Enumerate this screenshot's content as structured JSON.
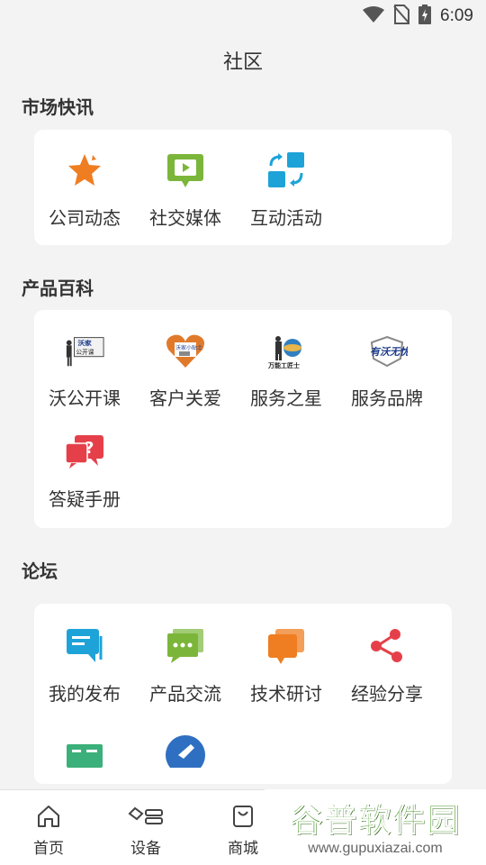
{
  "status": {
    "time": "6:09"
  },
  "header": {
    "title": "社区"
  },
  "sections": [
    {
      "title": "市场快讯",
      "items": [
        {
          "label": "公司动态",
          "icon": "star-icon"
        },
        {
          "label": "社交媒体",
          "icon": "video-chat-icon"
        },
        {
          "label": "互动活动",
          "icon": "exchange-icon"
        }
      ]
    },
    {
      "title": "产品百科",
      "items": [
        {
          "label": "沃公开课",
          "icon": "open-class-image",
          "image_text": "沃家 公开课"
        },
        {
          "label": "客户关爱",
          "icon": "customer-care-image",
          "image_text": "沃家小贴士"
        },
        {
          "label": "服务之星",
          "icon": "service-star-image",
          "image_text": "万能工匠士"
        },
        {
          "label": "服务品牌",
          "icon": "service-brand-image",
          "image_text": "有沃无忧"
        },
        {
          "label": "答疑手册",
          "icon": "question-icon"
        }
      ]
    },
    {
      "title": "论坛",
      "items": [
        {
          "label": "我的发布",
          "icon": "my-post-icon"
        },
        {
          "label": "产品交流",
          "icon": "chat-dots-icon"
        },
        {
          "label": "技术研讨",
          "icon": "discussion-icon"
        },
        {
          "label": "经验分享",
          "icon": "share-icon"
        }
      ]
    }
  ],
  "tabbar": {
    "items": [
      {
        "label": "首页",
        "icon": "home-icon"
      },
      {
        "label": "设备",
        "icon": "device-icon"
      },
      {
        "label": "商城",
        "icon": "shopping-bag-icon"
      }
    ]
  },
  "watermark": {
    "main": "谷普软件园",
    "sub": "www.gupuxiazai.com"
  },
  "colors": {
    "orange": "#ef7d22",
    "green": "#7bb63a",
    "blue": "#1ea3d8",
    "red": "#e5404a"
  }
}
